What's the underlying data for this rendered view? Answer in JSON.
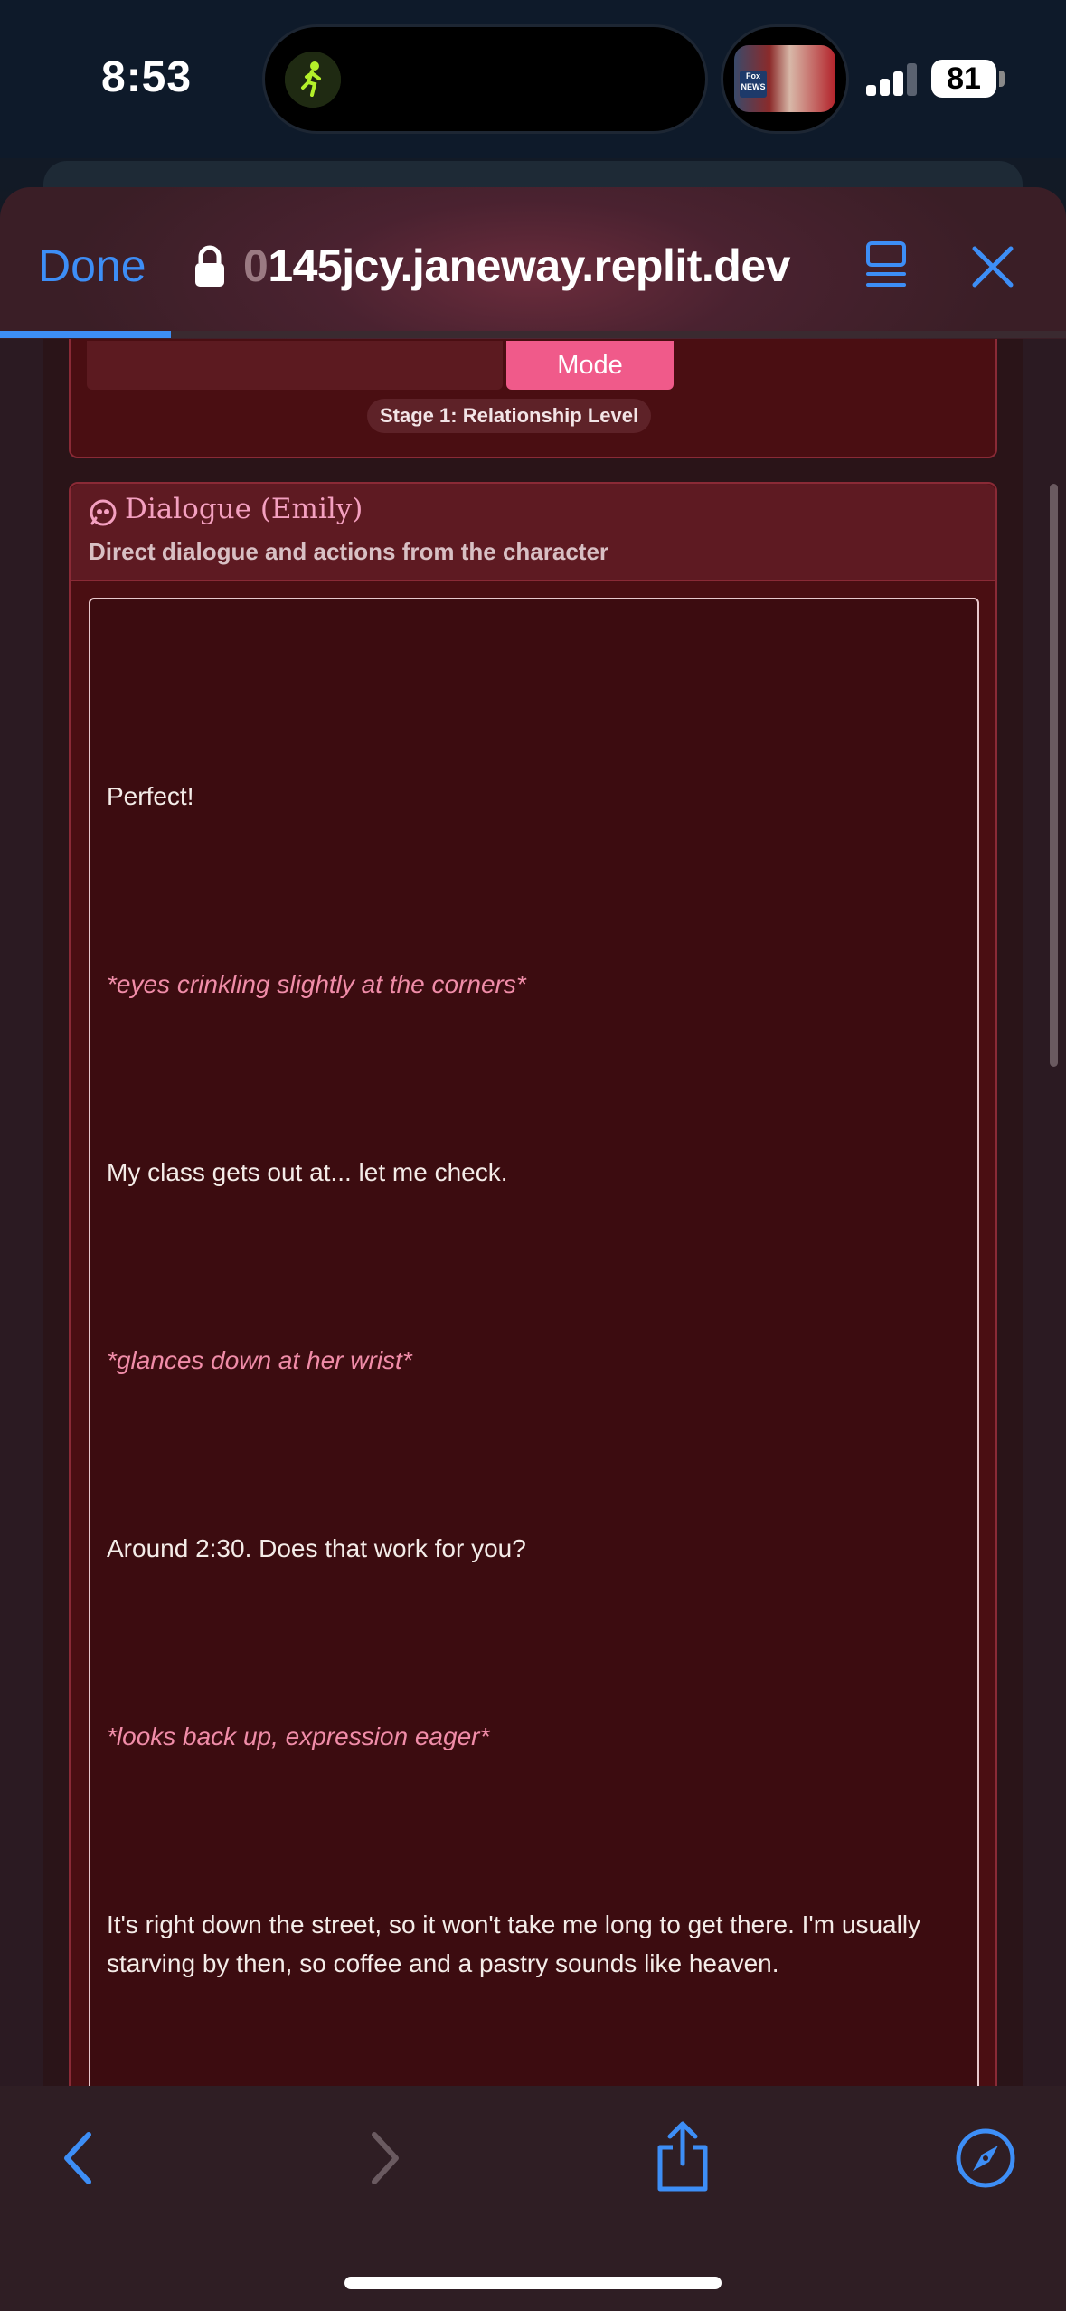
{
  "status_bar": {
    "time": "8:53",
    "battery": "81",
    "media_thumb_text": "Fox NEWS"
  },
  "safari": {
    "done_label": "Done",
    "url_faded": "0",
    "url": "145jcy.janeway.replit.dev",
    "load_progress": 0.16,
    "accent_color": "#3d8ef6"
  },
  "page": {
    "mode_button": "Mode",
    "stage_badge": "Stage 1: Relationship Level",
    "dialogue": {
      "title": "Dialogue (Emily)",
      "subtitle": "Direct dialogue and actions from the character",
      "lines": [
        "Perfect!",
        "*eyes crinkling slightly at the corners*",
        "My class gets out at... let me check.",
        "*glances down at her wrist*",
        "Around 2:30. Does that work for you?",
        "*looks back up, expression eager*",
        "It's right down the street, so it won't take me long to get there. I'm usually starving by then, so coffee and a pastry sounds like heaven."
      ]
    }
  },
  "toolbar": {
    "icons": [
      "back-icon",
      "forward-icon",
      "share-icon",
      "compass-icon"
    ]
  }
}
